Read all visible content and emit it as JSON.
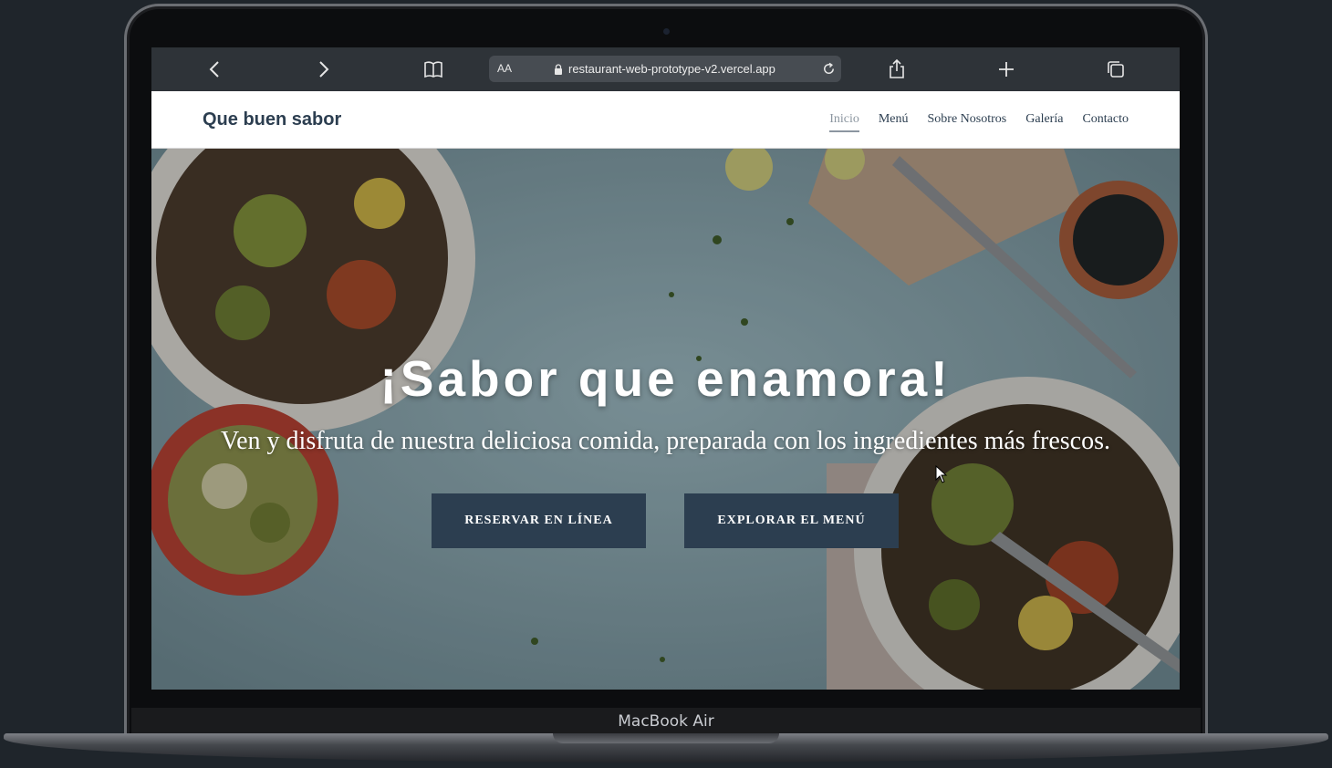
{
  "device": {
    "model_label": "MacBook Air"
  },
  "browser": {
    "url_aa": "AA",
    "url": "restaurant-web-prototype-v2.vercel.app",
    "icons": [
      "back-icon",
      "forward-icon",
      "bookmarks-icon",
      "lock-icon",
      "reload-icon",
      "share-icon",
      "new-tab-icon",
      "tabs-icon"
    ]
  },
  "site": {
    "brand": "Que buen sabor",
    "nav": [
      {
        "label": "Inicio",
        "active": true
      },
      {
        "label": "Menú",
        "active": false
      },
      {
        "label": "Sobre Nosotros",
        "active": false
      },
      {
        "label": "Galería",
        "active": false
      },
      {
        "label": "Contacto",
        "active": false
      }
    ]
  },
  "hero": {
    "title": "¡Sabor que enamora!",
    "subtitle": "Ven y disfruta de nuestra deliciosa comida, preparada con los ingredientes más frescos.",
    "reserve_button": "RESERVAR EN LÍNEA",
    "menu_button": "EXPLORAR EL MENÚ"
  },
  "colors": {
    "brand": "#2c3e50",
    "nav_active": "#8c96a0",
    "hero_bg": "#7f9aa3"
  }
}
